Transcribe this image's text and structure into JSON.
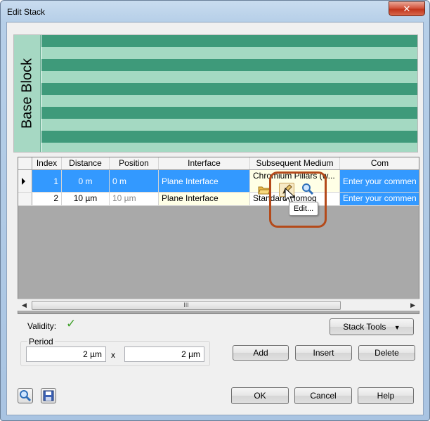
{
  "window": {
    "title": "Edit Stack",
    "close_glyph": "✕"
  },
  "preview": {
    "label": "Base Block"
  },
  "grid": {
    "columns": [
      "Index",
      "Distance",
      "Position",
      "Interface",
      "Subsequent Medium",
      "Com"
    ],
    "rows": [
      {
        "index": "1",
        "distance": "0 m",
        "position": "0 m",
        "interface": "Plane Interface",
        "medium": "Chromium Pillars (w...",
        "comment": "Enter your commen"
      },
      {
        "index": "2",
        "distance": "10 µm",
        "position": "10 µm",
        "interface": "Plane Interface",
        "medium": "Standard Homog",
        "comment": "Enter your commen"
      }
    ],
    "scroll_grip": "III"
  },
  "tooltip": {
    "text": "Edit..."
  },
  "validity": {
    "label": "Validity:"
  },
  "period": {
    "label": "Period",
    "value1": "2 µm",
    "separator": "x",
    "value2": "2 µm"
  },
  "buttons": {
    "stack_tools": "Stack Tools",
    "add": "Add",
    "insert": "Insert",
    "delete": "Delete",
    "ok": "OK",
    "cancel": "Cancel",
    "help": "Help"
  },
  "colors": {
    "selection": "#3399ff",
    "stripe_dark": "#3e9a7a",
    "stripe_light": "#a4d9c2"
  }
}
